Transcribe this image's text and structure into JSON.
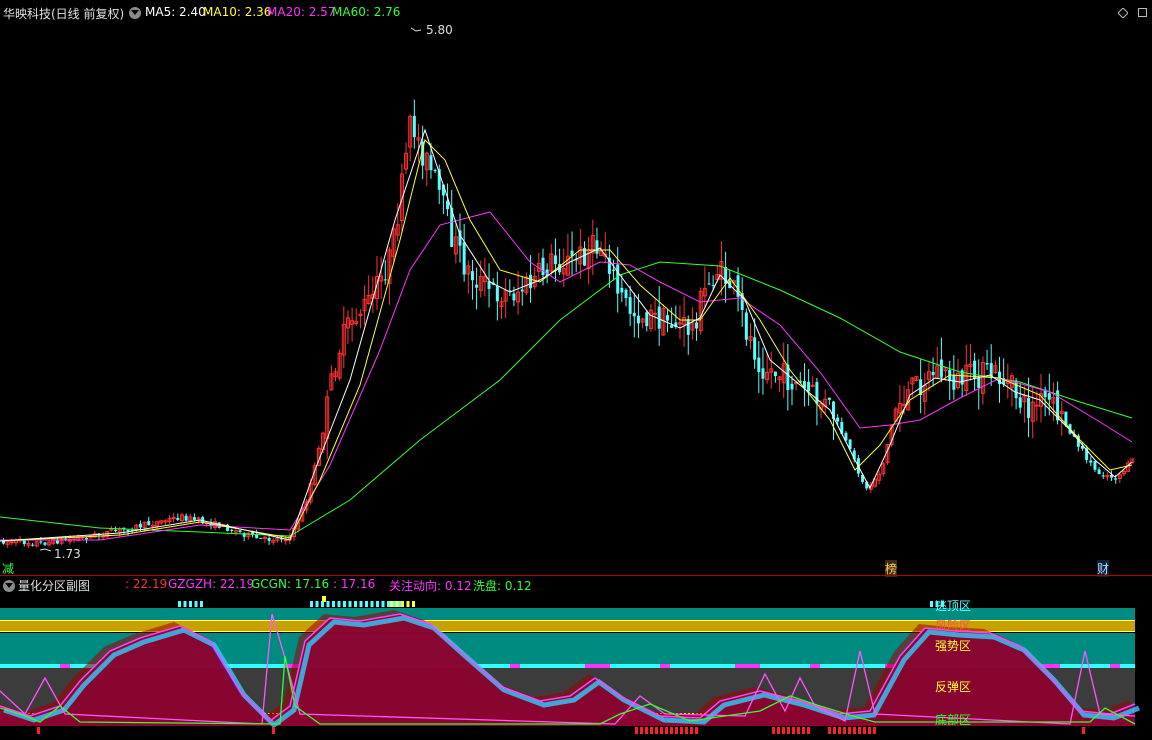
{
  "main_header": {
    "title": "华映科技(日线 前复权)",
    "ma5": "MA5: 2.40",
    "ma10": "MA10: 2.36",
    "ma20": "MA20: 2.57",
    "ma60": "MA60: 2.76"
  },
  "main_chart": {
    "high_label": "5.80",
    "low_label": "1.73",
    "markers": [
      "减",
      "榜",
      "财"
    ]
  },
  "sub_header": {
    "title": "量化分区副图",
    "v1": ": 22.19",
    "gzgzh": "GZGZH: 22.19",
    "gcgn": "GCGN: 17.16",
    "v4": ": 17.16",
    "gzdx": "关注动向: 0.12",
    "xp": "洗盘: 0.12"
  },
  "zones": {
    "top": "逃顶区",
    "risk": "风险区",
    "strong": "强势区",
    "rebound": "反弹区",
    "bottom": "底部区"
  },
  "colors": {
    "bg": "#000000",
    "up": "#ff3232",
    "down": "#54ffff",
    "ma5": "#ffffff",
    "ma10": "#ffff33",
    "ma20": "#ff33ff",
    "ma60": "#33ff33",
    "zone_teal": "#008b80",
    "zone_gold": "#c8a000",
    "zone_purple": "#6e0a6e",
    "zone_gray": "#3c3c3c",
    "zone_red": "#8c0000"
  },
  "icons": {
    "dropdown": "chevron-down-icon",
    "corner": "diamond-icon",
    "window": "square-icon"
  }
}
